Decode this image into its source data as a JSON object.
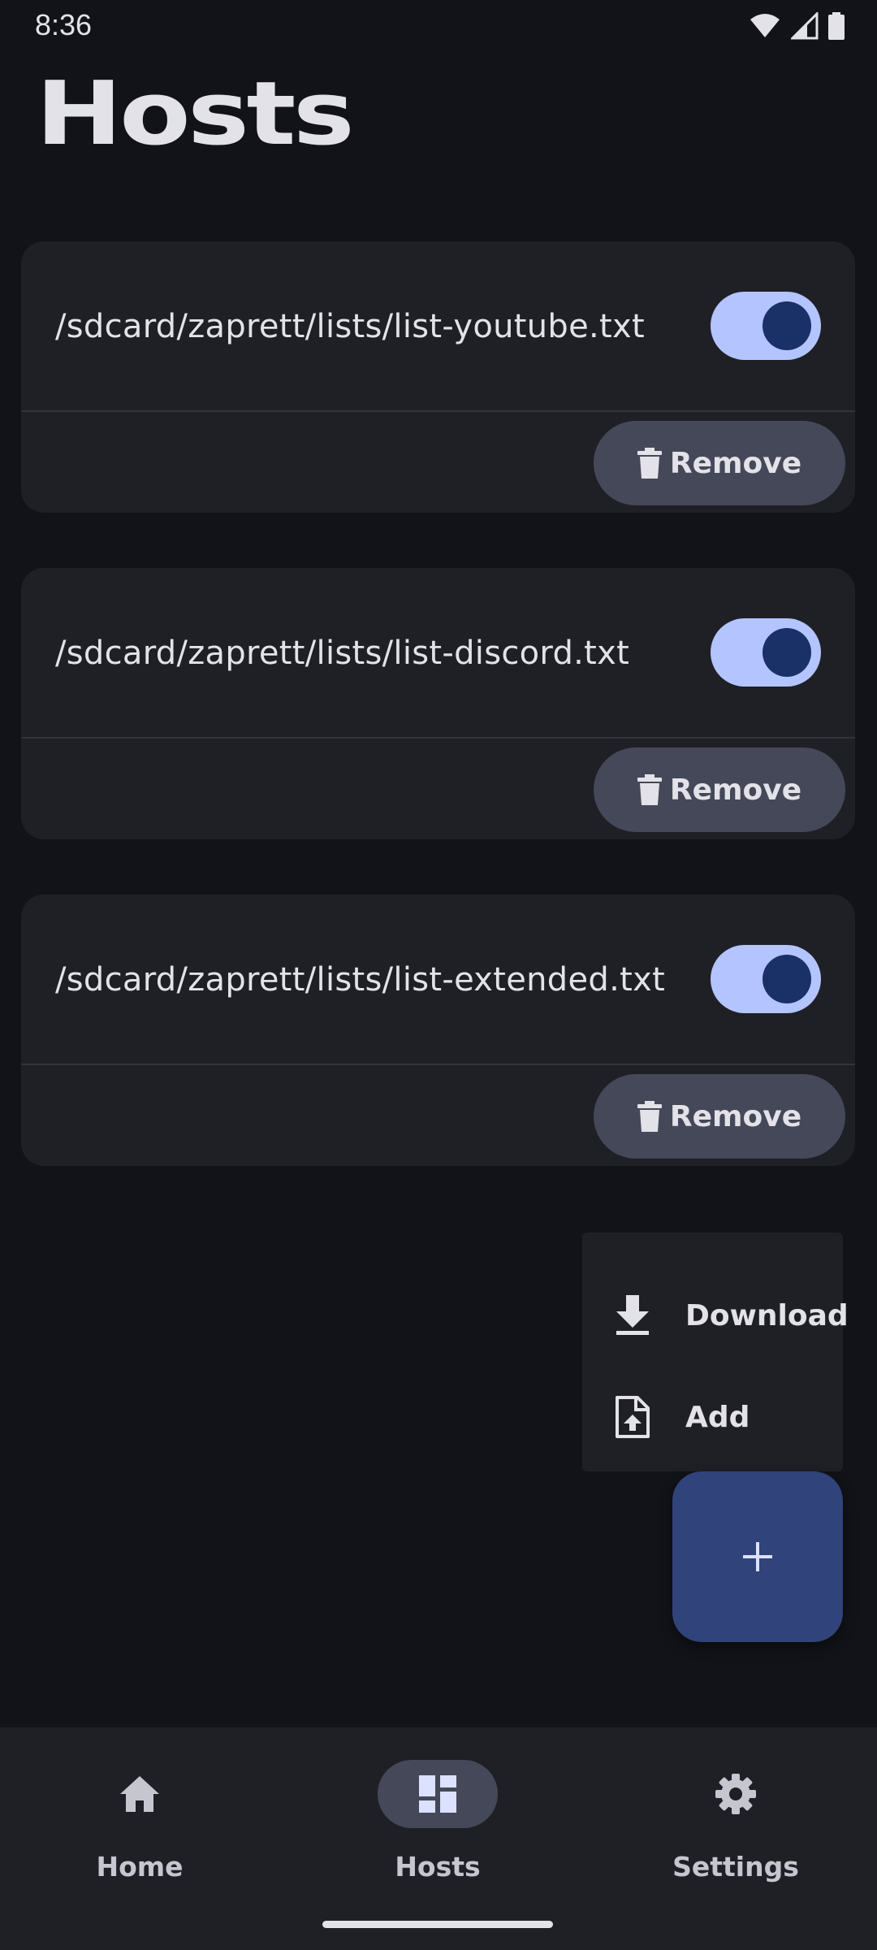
{
  "status_bar": {
    "time": "8:36",
    "icons": [
      "wifi-icon",
      "cell-signal-icon",
      "battery-icon"
    ]
  },
  "page": {
    "title": "Hosts"
  },
  "hosts": [
    {
      "path": "/sdcard/zaprett/lists/list-youtube.txt",
      "enabled": true,
      "remove_label": "Remove"
    },
    {
      "path": "/sdcard/zaprett/lists/list-discord.txt",
      "enabled": true,
      "remove_label": "Remove"
    },
    {
      "path": "/sdcard/zaprett/lists/list-extended.txt",
      "enabled": true,
      "remove_label": "Remove"
    }
  ],
  "fab_menu": {
    "items": [
      {
        "label": "Download",
        "icon": "download-icon"
      },
      {
        "label": "Add",
        "icon": "file-upload-icon"
      }
    ]
  },
  "fab": {
    "icon": "plus-icon"
  },
  "bottom_nav": {
    "items": [
      {
        "label": "Home",
        "icon": "home-icon",
        "active": false
      },
      {
        "label": "Hosts",
        "icon": "dashboard-icon",
        "active": true
      },
      {
        "label": "Settings",
        "icon": "gear-icon",
        "active": false
      }
    ]
  },
  "colors": {
    "background": "#121318",
    "surface": "#1f2026",
    "toggle_track": "#b4c4ff",
    "toggle_thumb": "#193166",
    "fab": "#30437a",
    "chip": "#444858"
  }
}
